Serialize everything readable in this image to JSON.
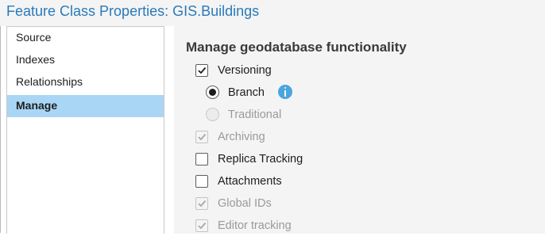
{
  "window": {
    "title": "Feature Class Properties: GIS.Buildings"
  },
  "sidebar": {
    "items": [
      {
        "label": "Source"
      },
      {
        "label": "Indexes"
      },
      {
        "label": "Relationships"
      },
      {
        "label": "Manage"
      }
    ],
    "selected": "Manage"
  },
  "main": {
    "section_title": "Manage geodatabase functionality",
    "options": {
      "versioning": {
        "label": "Versioning",
        "checked": true,
        "enabled": true
      },
      "branch": {
        "label": "Branch",
        "selected": true,
        "enabled": true,
        "icon": "info-icon"
      },
      "traditional": {
        "label": "Traditional",
        "selected": false,
        "enabled": false
      },
      "archiving": {
        "label": "Archiving",
        "checked": true,
        "enabled": false
      },
      "replica_tracking": {
        "label": "Replica Tracking",
        "checked": false,
        "enabled": true
      },
      "attachments": {
        "label": "Attachments",
        "checked": false,
        "enabled": true
      },
      "global_ids": {
        "label": "Global IDs",
        "checked": true,
        "enabled": false
      },
      "editor_tracking": {
        "label": "Editor tracking",
        "checked": true,
        "enabled": false
      }
    }
  },
  "colors": {
    "title": "#2a7ab9",
    "selected_bg": "#a9d6f5",
    "info_icon": "#4aa6dc",
    "disabled_text": "#9a9a9a"
  }
}
